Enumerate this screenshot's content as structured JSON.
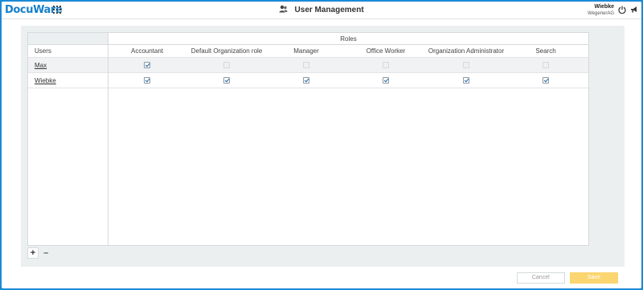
{
  "header": {
    "logo": "DocuWare",
    "title": "User Management",
    "user_name": "Wiebke",
    "user_org": "WegenerAG"
  },
  "grid": {
    "users_header": "Users",
    "roles_header": "Roles",
    "roles": [
      "Accountant",
      "Default Organization role",
      "Manager",
      "Office Worker",
      "Organization Administrator",
      "Search"
    ],
    "users": [
      {
        "name": "Max",
        "roles": [
          true,
          false,
          false,
          false,
          false,
          false
        ]
      },
      {
        "name": "Wiebke",
        "roles": [
          true,
          true,
          true,
          true,
          true,
          true
        ]
      }
    ],
    "add_label": "+",
    "remove_label": "–"
  },
  "footer": {
    "cancel_label": "Cancel",
    "save_label": "Save"
  },
  "colors": {
    "frame": "#1a8ad4",
    "logo": "#1580c9",
    "save_button": "#fbd56f",
    "panel": "#eceff0"
  }
}
